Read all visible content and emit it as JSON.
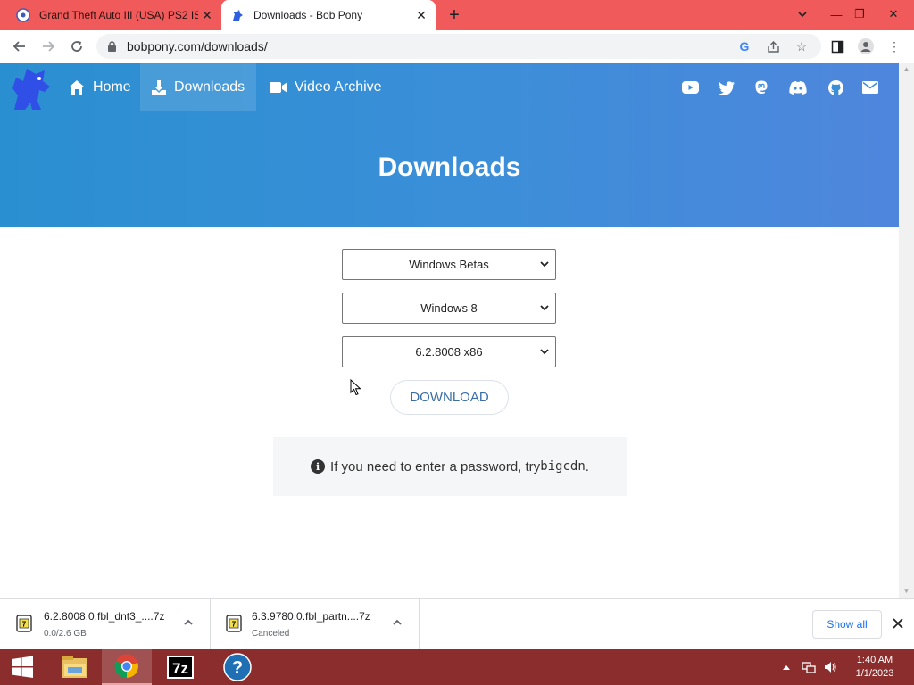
{
  "browser": {
    "tabs": [
      {
        "title": "Grand Theft Auto III (USA) PS2 IS",
        "active": false
      },
      {
        "title": "Downloads - Bob Pony",
        "active": true
      }
    ],
    "url": "bobpony.com/downloads/"
  },
  "site": {
    "nav": [
      {
        "label": "Home",
        "icon": "home-icon"
      },
      {
        "label": "Downloads",
        "icon": "download-icon",
        "active": true
      },
      {
        "label": "Video Archive",
        "icon": "video-camera-icon"
      }
    ],
    "social_icons": [
      "youtube-icon",
      "twitter-icon",
      "mastodon-icon",
      "discord-icon",
      "github-icon",
      "email-icon"
    ],
    "hero_title": "Downloads",
    "colors": {
      "header_start": "#2a8fd0",
      "header_end": "#4f86dd",
      "button_text": "#3a6ea5"
    }
  },
  "form": {
    "category_select": "Windows Betas",
    "version_select": "Windows 8",
    "build_select": "6.2.8008 x86",
    "download_label": "DOWNLOAD",
    "notice_text": "If you need to enter a password, try ",
    "notice_code": "bigcdn",
    "notice_end": "."
  },
  "downloads_shelf": {
    "items": [
      {
        "name": "6.2.8008.0.fbl_dnt3_....7z",
        "status": "0.0/2.6 GB"
      },
      {
        "name": "6.3.9780.0.fbl_partn....7z",
        "status": "Canceled"
      }
    ],
    "show_all_label": "Show all"
  },
  "taskbar": {
    "apps": [
      "start-icon",
      "file-explorer-icon",
      "chrome-icon",
      "7zip-icon",
      "help-icon"
    ],
    "time": "1:40 AM",
    "date": "1/1/2023"
  }
}
